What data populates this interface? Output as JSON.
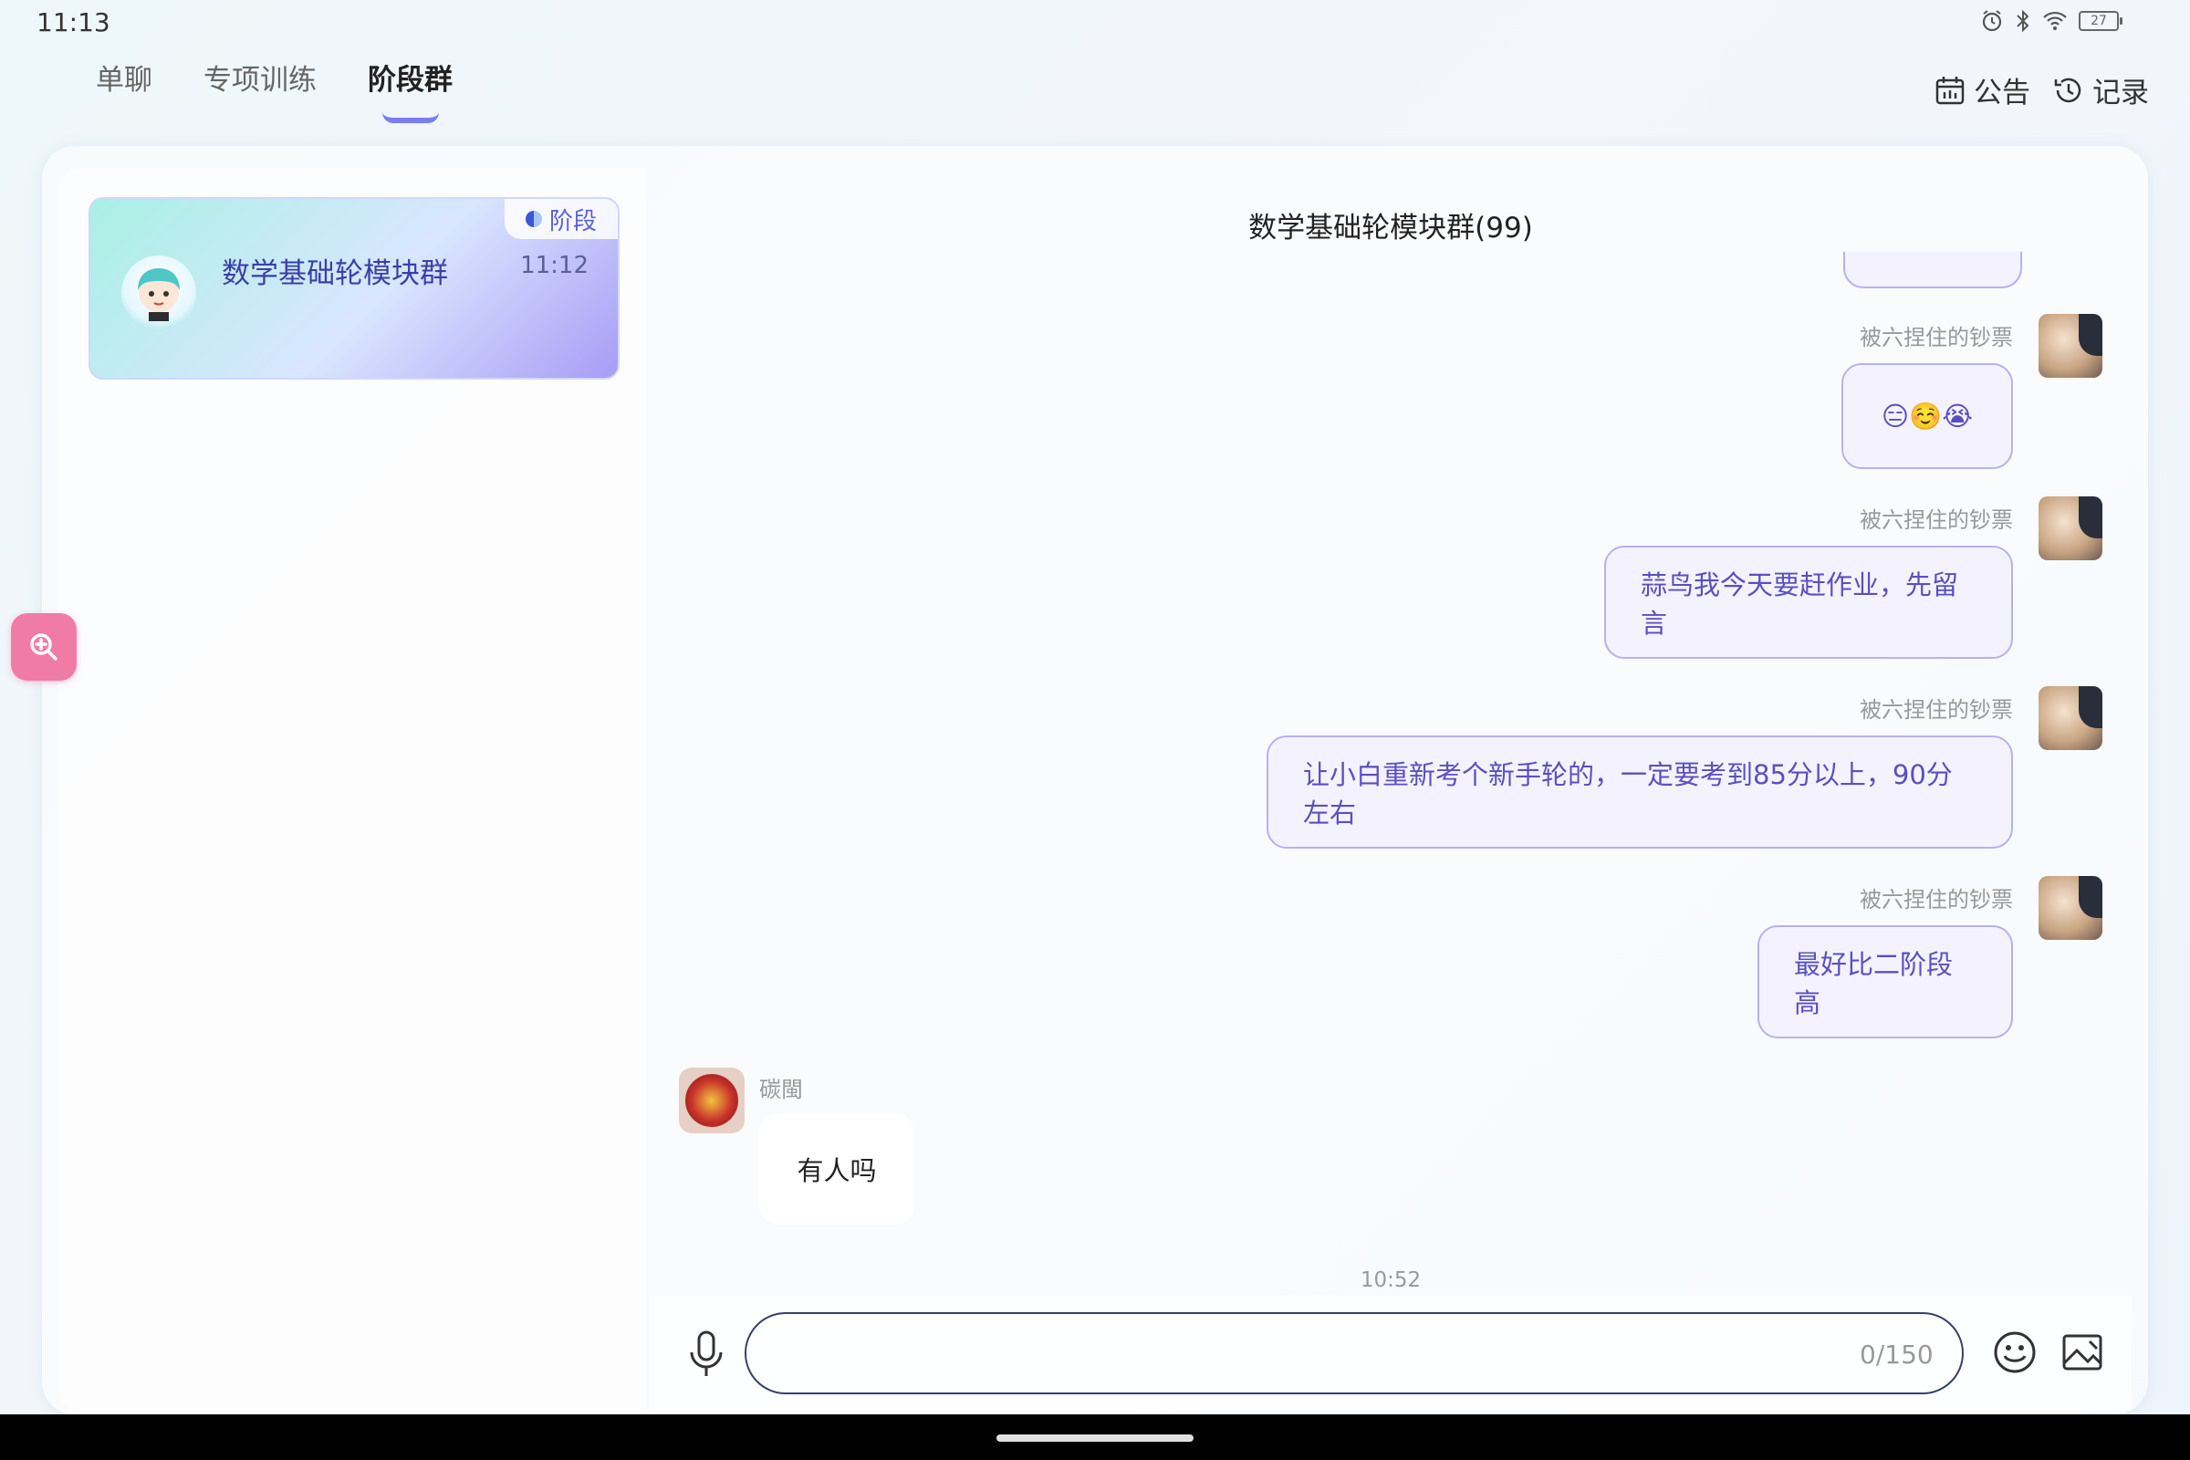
{
  "status_bar": {
    "time": "11:13",
    "battery": "27"
  },
  "tabs": [
    {
      "label": "单聊",
      "active": false
    },
    {
      "label": "专项训练",
      "active": false
    },
    {
      "label": "阶段群",
      "active": true
    }
  ],
  "top_actions": {
    "notice_label": "公告",
    "record_label": "记录"
  },
  "conversation": {
    "badge": "阶段",
    "name": "数学基础轮模块群",
    "time": "11:12"
  },
  "chat": {
    "title": "数学基础轮模块群(99)",
    "messages": [
      {
        "side": "right",
        "sender": "被六捏住的钞票",
        "text": "😑☺️😭"
      },
      {
        "side": "right",
        "sender": "被六捏住的钞票",
        "text": "蒜鸟我今天要赶作业，先留言"
      },
      {
        "side": "right",
        "sender": "被六捏住的钞票",
        "text": "让小白重新考个新手轮的，一定要考到85分以上，90分左右"
      },
      {
        "side": "right",
        "sender": "被六捏住的钞票",
        "text": "最好比二阶段高"
      },
      {
        "side": "left",
        "sender": "碳閩",
        "text": "有人吗"
      }
    ],
    "time_divider": "10:52"
  },
  "input": {
    "value": "",
    "char_count": "0/150"
  },
  "colors": {
    "accent": "#7a7ff0",
    "bubble_border": "#b9b0ef",
    "bubble_text": "#5a4fc2",
    "zoom_button": "#f07ba5"
  }
}
